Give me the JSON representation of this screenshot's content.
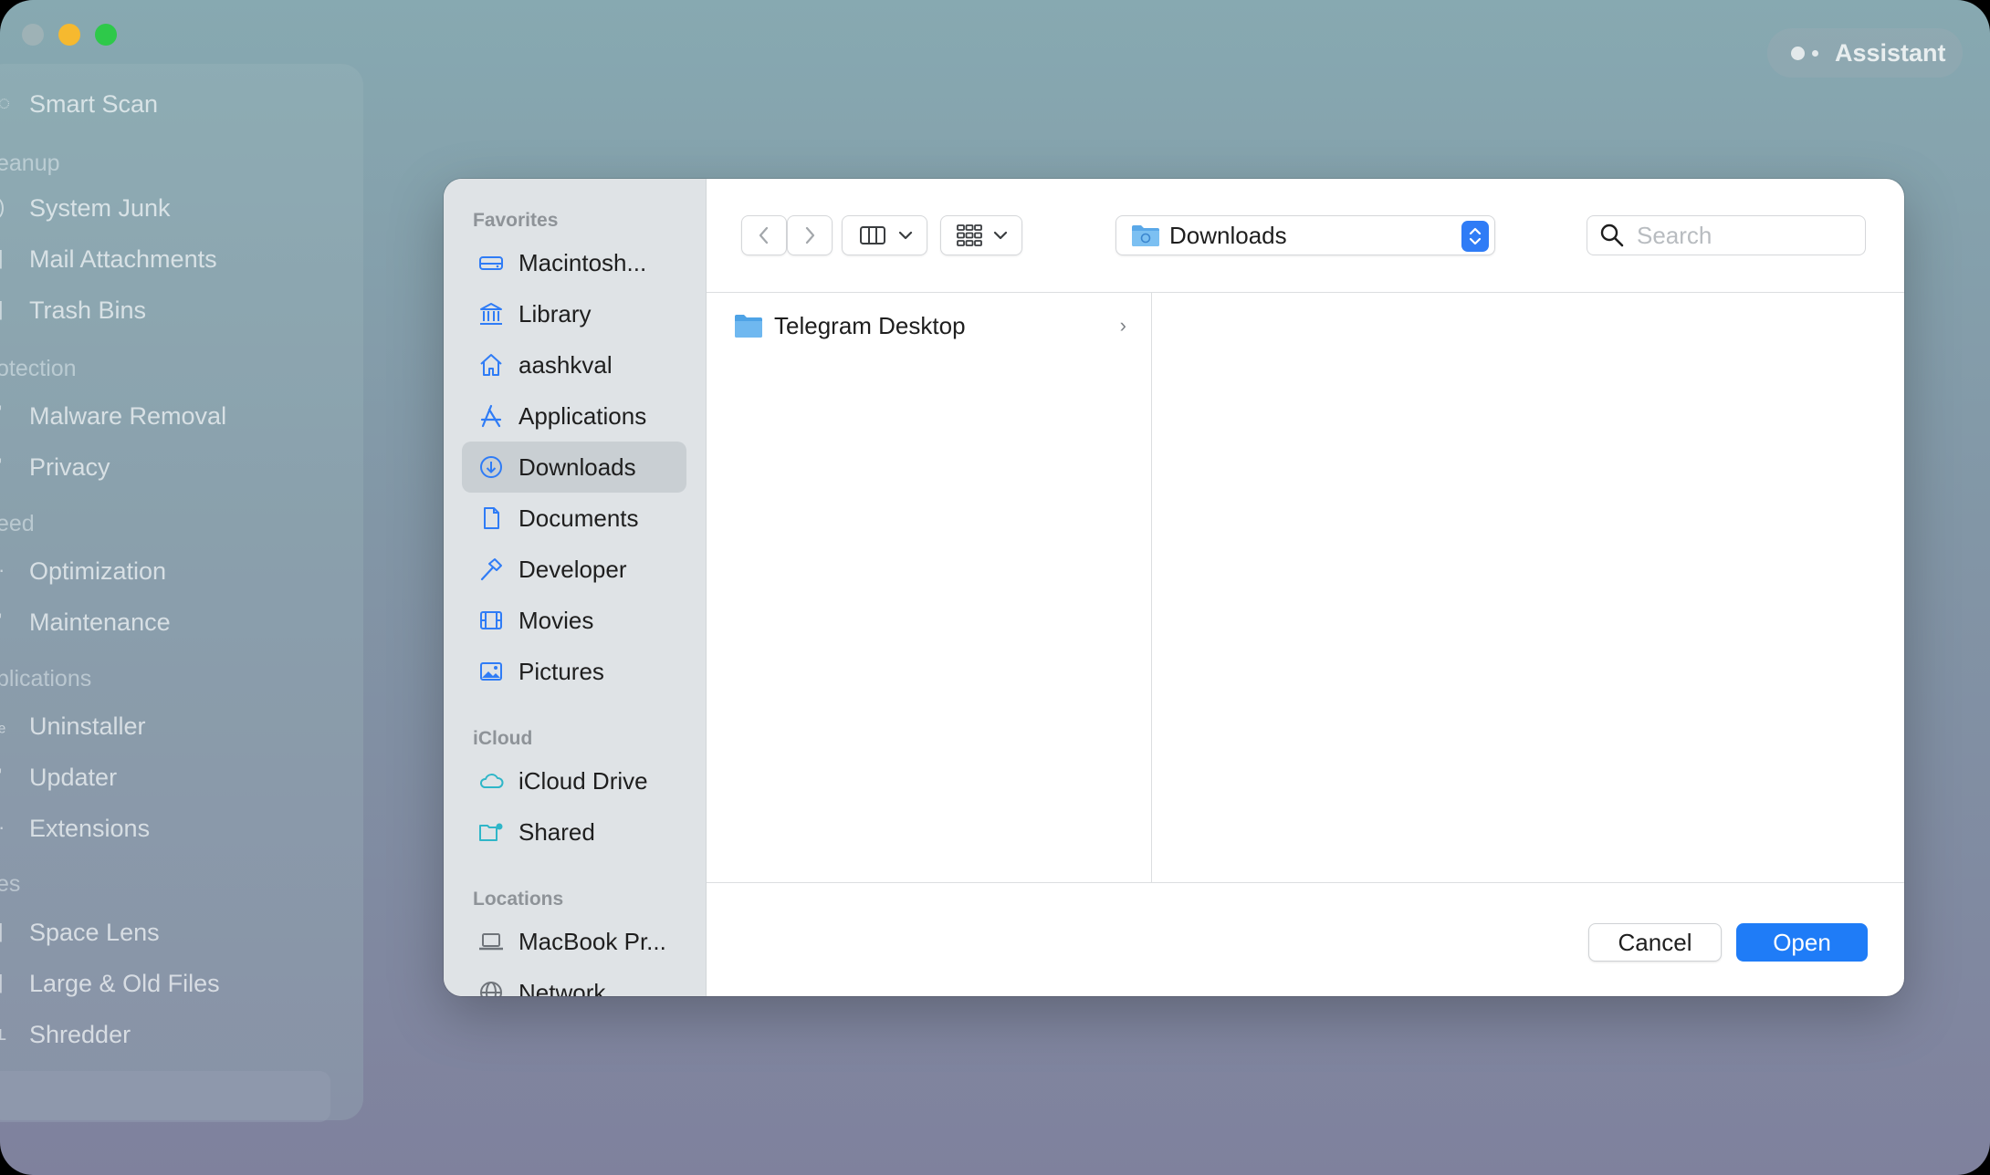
{
  "app": {
    "assistant_label": "Assistant",
    "sidebar": {
      "items": [
        {
          "label": "Smart Scan",
          "type": "item"
        },
        {
          "label": "eanup",
          "type": "section"
        },
        {
          "label": "System Junk",
          "type": "item"
        },
        {
          "label": "Mail Attachments",
          "type": "item"
        },
        {
          "label": "Trash Bins",
          "type": "item"
        },
        {
          "label": "otection",
          "type": "section"
        },
        {
          "label": "Malware Removal",
          "type": "item"
        },
        {
          "label": "Privacy",
          "type": "item"
        },
        {
          "label": "eed",
          "type": "section"
        },
        {
          "label": "Optimization",
          "type": "item"
        },
        {
          "label": "Maintenance",
          "type": "item"
        },
        {
          "label": "plications",
          "type": "section"
        },
        {
          "label": "Uninstaller",
          "type": "item"
        },
        {
          "label": "Updater",
          "type": "item"
        },
        {
          "label": "Extensions",
          "type": "item"
        },
        {
          "label": "es",
          "type": "section"
        },
        {
          "label": "Space Lens",
          "type": "item"
        },
        {
          "label": "Large & Old Files",
          "type": "item"
        },
        {
          "label": "Shredder",
          "type": "item",
          "selected": true
        }
      ]
    }
  },
  "dialog": {
    "sidebar": {
      "favorites_title": "Favorites",
      "favorites": [
        {
          "label": "Macintosh...",
          "icon": "hard-drive-icon"
        },
        {
          "label": "Library",
          "icon": "library-icon"
        },
        {
          "label": "aashkval",
          "icon": "home-icon"
        },
        {
          "label": "Applications",
          "icon": "applications-icon"
        },
        {
          "label": "Downloads",
          "icon": "downloads-icon",
          "selected": true
        },
        {
          "label": "Documents",
          "icon": "document-icon"
        },
        {
          "label": "Developer",
          "icon": "hammer-icon"
        },
        {
          "label": "Movies",
          "icon": "film-icon"
        },
        {
          "label": "Pictures",
          "icon": "photo-icon"
        }
      ],
      "icloud_title": "iCloud",
      "icloud": [
        {
          "label": "iCloud Drive",
          "icon": "cloud-icon"
        },
        {
          "label": "Shared",
          "icon": "shared-folder-icon"
        }
      ],
      "locations_title": "Locations",
      "locations": [
        {
          "label": "MacBook Pr...",
          "icon": "laptop-icon"
        },
        {
          "label": "Network",
          "icon": "globe-icon"
        }
      ]
    },
    "path_label": "Downloads",
    "search_placeholder": "Search",
    "files": [
      {
        "name": "Telegram Desktop",
        "kind": "folder"
      }
    ],
    "cancel_label": "Cancel",
    "open_label": "Open"
  },
  "colors": {
    "accent": "#1f7cf7",
    "icon_blue": "#2f7cf6",
    "window_bg_top": "#87a9b1",
    "window_bg_bottom": "#7f819d"
  }
}
